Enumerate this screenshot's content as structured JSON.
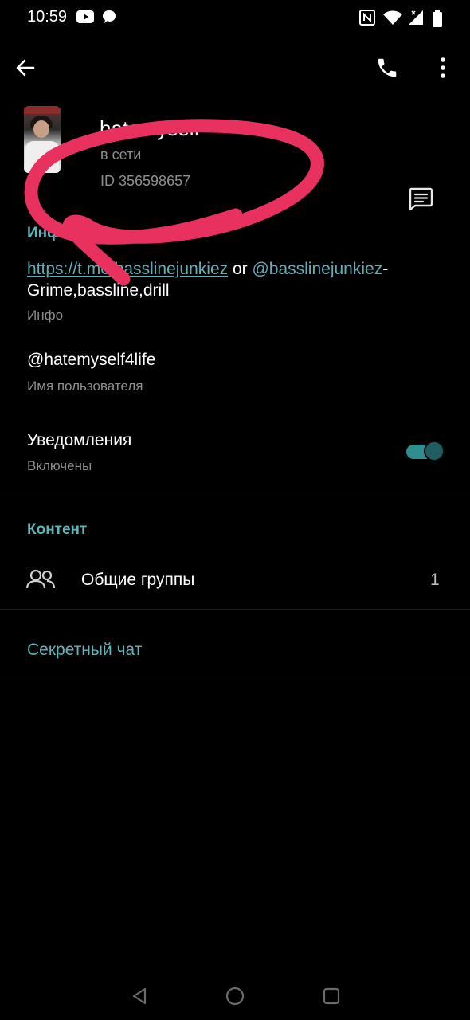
{
  "status_bar": {
    "time": "10:59",
    "icons": [
      "youtube-icon",
      "message-bubble-icon",
      "nfc-icon",
      "wifi-icon",
      "signal-icon",
      "battery-icon"
    ]
  },
  "app_bar": {
    "icons": [
      "back-arrow-icon",
      "phone-icon",
      "more-vertical-icon"
    ]
  },
  "profile": {
    "name": "hatemyself",
    "status": "в сети",
    "id_text": "ID 356598657"
  },
  "info_section": {
    "title": "Инфо",
    "bio_link": "https://t.me/basslinejunkiez",
    "bio_or": " or ",
    "bio_mention": "@basslinejunkiez",
    "bio_rest": "-Grime,bassline,drill",
    "bio_caption": "Инфо",
    "username": "@hatemyself4life",
    "username_caption": "Имя пользователя",
    "notifications_label": "Уведомления",
    "notifications_state": "Включены",
    "notifications_on": true
  },
  "content_section": {
    "title": "Контент",
    "groups_label": "Общие группы",
    "groups_count": "1"
  },
  "secret_chat_label": "Секретный чат",
  "colors": {
    "background": "#000000",
    "accent": "#5fb6b8",
    "secondary_text": "#8e8e8e",
    "scribble": "#e8315e"
  }
}
